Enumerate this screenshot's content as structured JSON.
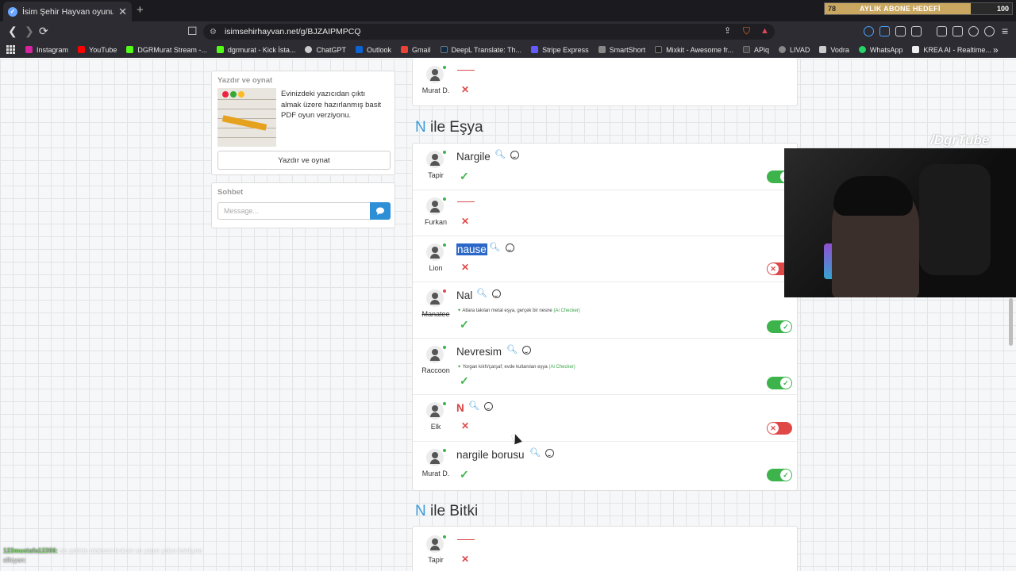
{
  "tab": {
    "title": "İsim Şehir Hayvan oyununa katıl",
    "new_tab": "+"
  },
  "sub_goal": {
    "count": "78",
    "label": "AYLIK ABONE HEDEFİ",
    "target": "100",
    "progress": 0.78
  },
  "address_bar": {
    "url": "isimsehirhayvan.net/g/BJZAIPMPCQ"
  },
  "bookmarks": [
    {
      "label": "Instagram",
      "color": "#d6249f"
    },
    {
      "label": "YouTube",
      "color": "#ff0000"
    },
    {
      "label": "DGRMurat Stream -...",
      "color": "#53fc18"
    },
    {
      "label": "dgrmurat - Kick İsta...",
      "color": "#53fc18"
    },
    {
      "label": "ChatGPT",
      "color": "#cccccc"
    },
    {
      "label": "Outlook",
      "color": "#0a64d6"
    },
    {
      "label": "Gmail",
      "color": "#ea4335"
    },
    {
      "label": "DeepL Translate: Th...",
      "color": "#0f2b46"
    },
    {
      "label": "Stripe Express",
      "color": "#635bff"
    },
    {
      "label": "SmartShort",
      "color": "#888888"
    },
    {
      "label": "Mixkit - Awesome fr...",
      "color": "#222222"
    },
    {
      "label": "APiq",
      "color": "#444444"
    },
    {
      "label": "LIVAD",
      "color": "#888888"
    },
    {
      "label": "Vodra",
      "color": "#cccccc"
    },
    {
      "label": "WhatsApp",
      "color": "#25d366"
    },
    {
      "label": "KREA AI - Realtime...",
      "color": "#eeeeee"
    }
  ],
  "print_panel": {
    "title": "Yazdır ve oynat",
    "description": "Evinizdeki yazıcıdan çıktı almak üzere hazırlanmış basit PDF oyun verziyonu.",
    "button": "Yazdır ve oynat"
  },
  "chat_panel": {
    "title": "Sohbet",
    "placeholder": "Message..."
  },
  "top_row": {
    "player": "Murat D."
  },
  "esya": {
    "letter": "N",
    "title": "ile Eşya",
    "rows": [
      {
        "player": "Tapir",
        "answer": "Nargile",
        "status": "ok",
        "toggle": "on"
      },
      {
        "player": "Furkan",
        "answer": "",
        "status": "x",
        "toggle": "none"
      },
      {
        "player": "Lion",
        "answer": "nause",
        "status": "x",
        "toggle": "off",
        "selected": true
      },
      {
        "player": "Manatee",
        "answer": "Nal",
        "status": "ok",
        "toggle": "on",
        "ai_note": "Atlara takılan metal eşya, gerçek bir nesne",
        "ai_tag": "(Ai Checker)"
      },
      {
        "player": "Raccoon",
        "answer": "Nevresim",
        "status": "ok",
        "toggle": "on",
        "ai_note": "Yorgan kılıfı/çarşaf; evde kullanılan eşya",
        "ai_tag": "(Ai Checker)"
      },
      {
        "player": "Elk",
        "answer": "N",
        "status": "x",
        "toggle": "off"
      },
      {
        "player": "Murat D.",
        "answer": "nargile borusu",
        "status": "ok",
        "toggle": "on"
      }
    ]
  },
  "bitki": {
    "letter": "N",
    "title": "ile Bitki",
    "rows": [
      {
        "player": "Tapir",
        "answer": "",
        "status": "x"
      }
    ]
  },
  "stream_overlay": {
    "watermark": "/DgrTube",
    "chat_user": "123mustafa12306:",
    "chat_message": "sis şehirle alakasız bokum ve yapın yakın katılıyım",
    "chat_user2": "sflicyon:"
  },
  "colors": {
    "accent": "#3a9ad9",
    "ok": "#3cb44b",
    "error": "#e04848"
  }
}
